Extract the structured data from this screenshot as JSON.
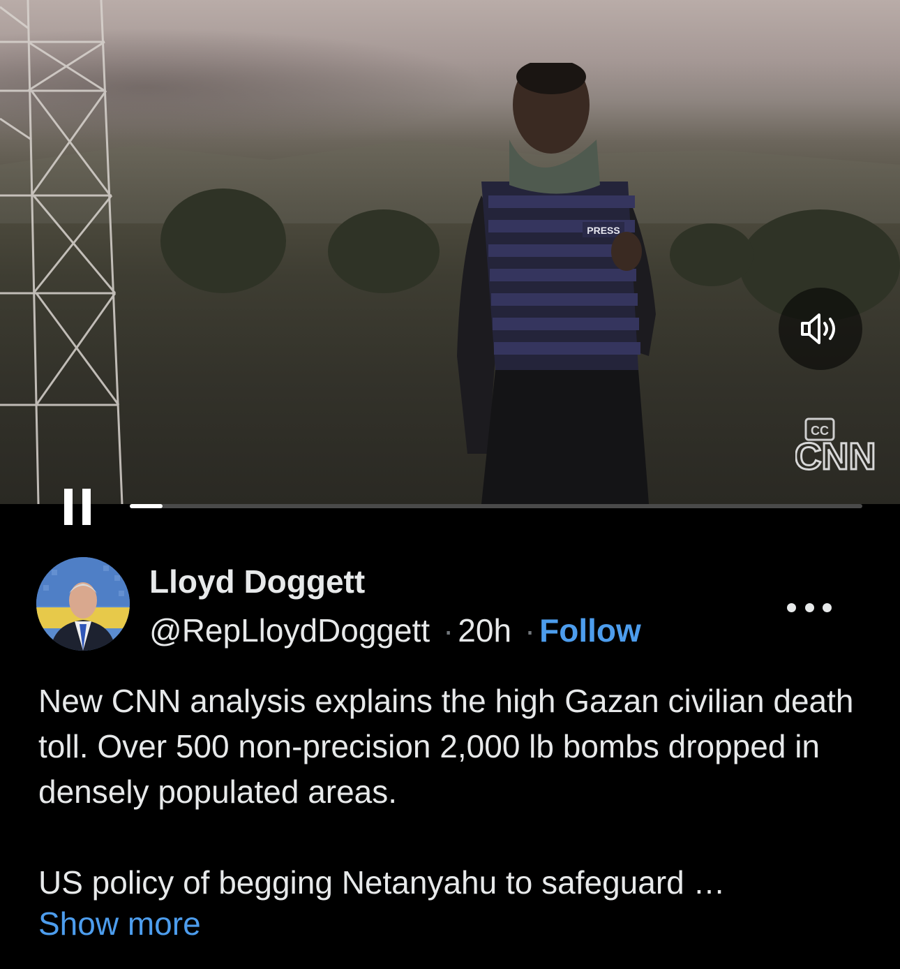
{
  "video": {
    "vest_badge": "PRESS",
    "logo_text": "CNN",
    "cc_label": "CC",
    "sound_icon": "speaker-on-icon",
    "pause_icon": "pause-icon",
    "progress": 0.045
  },
  "tweet": {
    "author_name": "Lloyd Doggett",
    "handle": "@RepLloydDoggett",
    "separator": "·",
    "time": "20h",
    "follow_label": "Follow",
    "more_icon": "more-options-icon",
    "text_para1": "New CNN analysis explains the high Gazan civilian death toll. Over 500 non-precision 2,000 lb bombs dropped in densely populated areas.",
    "text_para2": "US policy of begging Netanyahu to safeguard …",
    "show_more_label": "Show more"
  },
  "colors": {
    "background": "#000000",
    "text": "#e7e9ea",
    "link": "#4d9ded",
    "muted": "#71767b"
  }
}
